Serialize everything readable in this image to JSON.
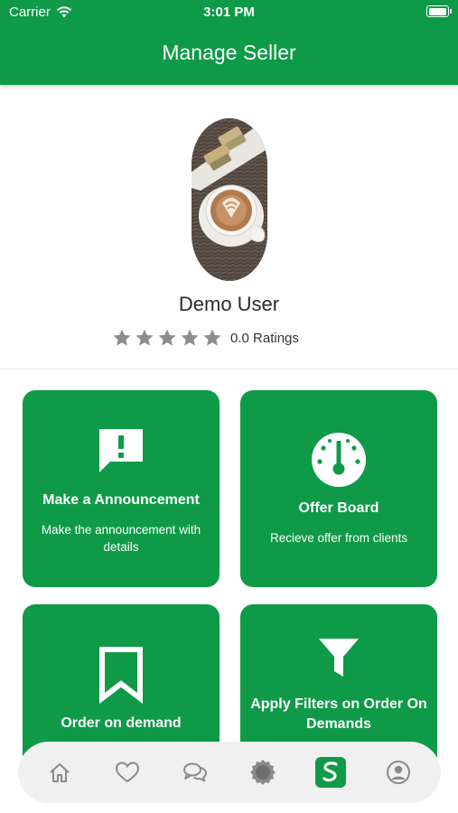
{
  "status_bar": {
    "carrier": "Carrier",
    "time": "3:01 PM",
    "battery_level": 1.0
  },
  "header": {
    "title": "Manage Seller"
  },
  "profile": {
    "avatar": "coffee-photo",
    "name": "Demo User",
    "stars_filled": 0,
    "stars_total": 5,
    "rating_text": "0.0 Ratings"
  },
  "cards": [
    {
      "title": "Make a Announcement",
      "description": "Make the announcement with details",
      "icon": "announcement-icon"
    },
    {
      "title": "Offer Board",
      "description": "Recieve offer from clients",
      "icon": "gauge-icon"
    },
    {
      "title": "Order on demand",
      "description": "",
      "icon": "bookmark-icon"
    },
    {
      "title": "Apply Filters on Order On Demands",
      "description": "",
      "icon": "filter-icon"
    }
  ],
  "tabbar": {
    "items": [
      "home-icon",
      "heart-icon",
      "chat-icon",
      "badge-icon",
      "seller-icon",
      "profile-icon"
    ],
    "active": "seller-icon"
  },
  "colors": {
    "primary": "#0f9a47",
    "tabbar_bg": "#f0f0f0",
    "icon_gray": "#8a8a8a"
  }
}
